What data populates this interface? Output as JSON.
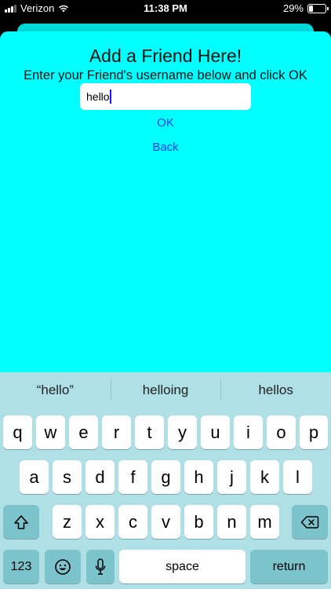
{
  "status_bar": {
    "carrier": "Verizon",
    "time": "11:38 PM",
    "battery_percent": "29%",
    "battery_level": 0.29,
    "icons": [
      "signal-icon",
      "wifi-icon",
      "battery-icon"
    ]
  },
  "colors": {
    "sheet_background": "#00FFFF",
    "keyboard_background": "#AEE0E6",
    "link_color": "#1A3CFF"
  },
  "form": {
    "title": "Add a Friend Here!",
    "subtitle": "Enter your Friend's username below and click OK",
    "username_value": "hello",
    "ok_label": "OK",
    "back_label": "Back"
  },
  "keyboard": {
    "suggestions": [
      "“hello”",
      "helloing",
      "hellos"
    ],
    "row1": [
      "q",
      "w",
      "e",
      "r",
      "t",
      "y",
      "u",
      "i",
      "o",
      "p"
    ],
    "row2": [
      "a",
      "s",
      "d",
      "f",
      "g",
      "h",
      "j",
      "k",
      "l"
    ],
    "row3": [
      "z",
      "x",
      "c",
      "v",
      "b",
      "n",
      "m"
    ],
    "numbers_label": "123",
    "space_label": "space",
    "return_label": "return"
  }
}
